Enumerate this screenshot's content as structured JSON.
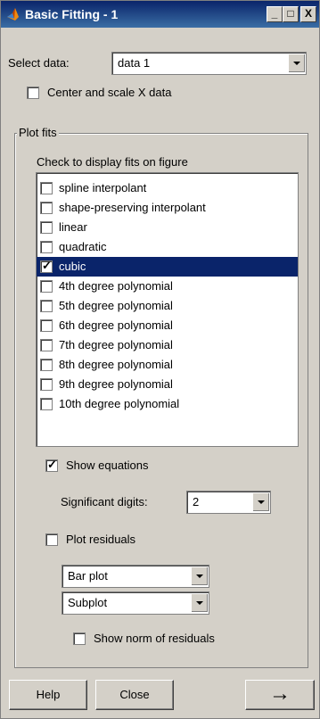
{
  "window": {
    "title": "Basic Fitting - 1",
    "minimize": "_",
    "maximize": "□",
    "close": "X"
  },
  "select_data": {
    "label": "Select data:",
    "value": "data 1"
  },
  "center_scale": {
    "label": "Center and scale X data",
    "checked": false
  },
  "plot_fits": {
    "group_title": "Plot fits",
    "instructions": "Check to display fits on figure",
    "items": [
      {
        "label": "spline interpolant",
        "checked": false,
        "selected": false
      },
      {
        "label": "shape-preserving interpolant",
        "checked": false,
        "selected": false
      },
      {
        "label": "linear",
        "checked": false,
        "selected": false
      },
      {
        "label": "quadratic",
        "checked": false,
        "selected": false
      },
      {
        "label": "cubic",
        "checked": true,
        "selected": true
      },
      {
        "label": "4th degree polynomial",
        "checked": false,
        "selected": false
      },
      {
        "label": "5th degree polynomial",
        "checked": false,
        "selected": false
      },
      {
        "label": "6th degree polynomial",
        "checked": false,
        "selected": false
      },
      {
        "label": "7th degree polynomial",
        "checked": false,
        "selected": false
      },
      {
        "label": "8th degree polynomial",
        "checked": false,
        "selected": false
      },
      {
        "label": "9th degree polynomial",
        "checked": false,
        "selected": false
      },
      {
        "label": "10th degree polynomial",
        "checked": false,
        "selected": false
      }
    ],
    "show_equations": {
      "label": "Show equations",
      "checked": true
    },
    "significant_digits": {
      "label": "Significant digits:",
      "value": "2"
    },
    "plot_residuals": {
      "label": "Plot residuals",
      "checked": false
    },
    "residual_plot_type": "Bar plot",
    "residual_location": "Subplot",
    "show_norm": {
      "label": "Show norm of residuals",
      "checked": false
    }
  },
  "buttons": {
    "help": "Help",
    "close": "Close",
    "next": "→"
  },
  "colors": {
    "title_bg": "#0a246a",
    "selection": "#0a246a",
    "face": "#d4d0c8"
  }
}
